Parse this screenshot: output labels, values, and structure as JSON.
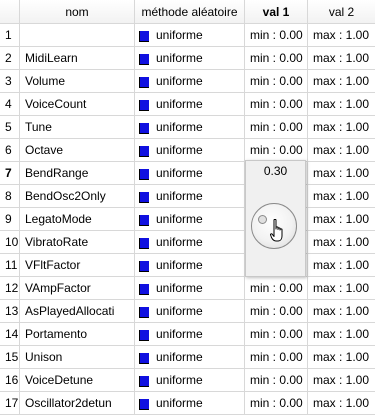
{
  "columns": {
    "num": "",
    "nom": "nom",
    "methode": "méthode aléatoire",
    "val1": "val 1",
    "val2": "val 2"
  },
  "rows": [
    {
      "num": "1",
      "nom": "",
      "methode": "uniforme",
      "val1": "min : 0.00",
      "val2": "max : 1.00"
    },
    {
      "num": "2",
      "nom": "MidiLearn",
      "methode": "uniforme",
      "val1": "min : 0.00",
      "val2": "max : 1.00"
    },
    {
      "num": "3",
      "nom": "Volume",
      "methode": "uniforme",
      "val1": "min : 0.00",
      "val2": "max : 1.00"
    },
    {
      "num": "4",
      "nom": "VoiceCount",
      "methode": "uniforme",
      "val1": "min : 0.00",
      "val2": "max : 1.00"
    },
    {
      "num": "5",
      "nom": "Tune",
      "methode": "uniforme",
      "val1": "min : 0.00",
      "val2": "max : 1.00"
    },
    {
      "num": "6",
      "nom": "Octave",
      "methode": "uniforme",
      "val1": "min : 0.00",
      "val2": "max : 1.00"
    },
    {
      "num": "7",
      "nom": "BendRange",
      "methode": "uniforme",
      "val1": "",
      "val2": "max : 1.00",
      "bold_num": true
    },
    {
      "num": "8",
      "nom": "BendOsc2Only",
      "methode": "uniforme",
      "val1": "",
      "val2": "max : 1.00"
    },
    {
      "num": "9",
      "nom": "LegatoMode",
      "methode": "uniforme",
      "val1": "",
      "val2": "max : 1.00"
    },
    {
      "num": "10",
      "nom": "VibratoRate",
      "methode": "uniforme",
      "val1": "",
      "val2": "max : 1.00"
    },
    {
      "num": "11",
      "nom": "VFltFactor",
      "methode": "uniforme",
      "val1": "",
      "val2": "max : 1.00"
    },
    {
      "num": "12",
      "nom": "VAmpFactor",
      "methode": "uniforme",
      "val1": "min : 0.00",
      "val2": "max : 1.00"
    },
    {
      "num": "13",
      "nom": "AsPlayedAllocati",
      "methode": "uniforme",
      "val1": "min : 0.00",
      "val2": "max : 1.00"
    },
    {
      "num": "14",
      "nom": "Portamento",
      "methode": "uniforme",
      "val1": "min : 0.00",
      "val2": "max : 1.00"
    },
    {
      "num": "15",
      "nom": "Unison",
      "methode": "uniforme",
      "val1": "min : 0.00",
      "val2": "max : 1.00"
    },
    {
      "num": "16",
      "nom": "VoiceDetune",
      "methode": "uniforme",
      "val1": "min : 0.00",
      "val2": "max : 1.00"
    },
    {
      "num": "17",
      "nom": "Oscillator2detun",
      "methode": "uniforme",
      "val1": "min : 0.00",
      "val2": "max : 1.00"
    }
  ],
  "knob_popup": {
    "value_label": "0.30",
    "value": 0.3
  },
  "colors": {
    "method_icon": "#1010e0",
    "grid_line": "#d8d8d8"
  },
  "icons": {
    "method": "blue-square-icon",
    "cursor": "hand-pointer-icon"
  }
}
